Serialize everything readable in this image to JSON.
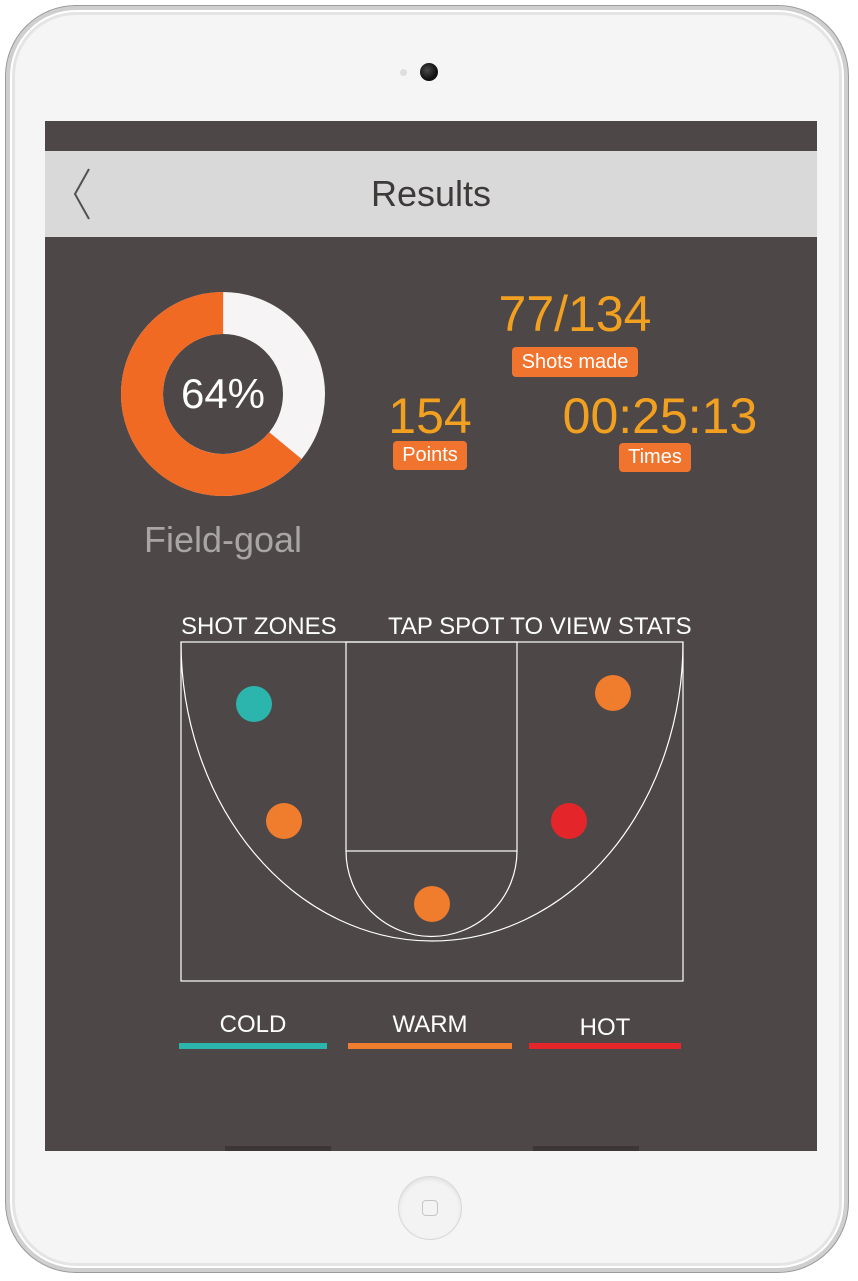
{
  "header": {
    "title": "Results"
  },
  "field_goal": {
    "percent_label": "64%",
    "percent": 64,
    "caption": "Field-goal"
  },
  "stats": {
    "shots_made": {
      "value": "77/134",
      "label": "Shots made"
    },
    "points": {
      "value": "154",
      "label": "Points"
    },
    "time": {
      "value": "00:25:13",
      "label": "Times"
    }
  },
  "shot_zones": {
    "title_left": "SHOT ZONES",
    "title_right": "TAP SPOT TO VIEW STATS",
    "spots": [
      {
        "zone": "left-corner",
        "heat": "cold"
      },
      {
        "zone": "left-wing",
        "heat": "warm"
      },
      {
        "zone": "paint",
        "heat": "warm"
      },
      {
        "zone": "right-wing",
        "heat": "hot"
      },
      {
        "zone": "right-corner",
        "heat": "warm"
      }
    ]
  },
  "legend": [
    {
      "label": "COLD",
      "color": "#2bb5ac"
    },
    {
      "label": "WARM",
      "color": "#f07c2d"
    },
    {
      "label": "HOT",
      "color": "#e4262b"
    }
  ],
  "colors": {
    "screen_bg": "#4d4747",
    "accent": "#f0742d",
    "stat_text": "#f2a01f",
    "cold": "#2bb5ac",
    "warm": "#f07c2d",
    "hot": "#e4262b"
  }
}
